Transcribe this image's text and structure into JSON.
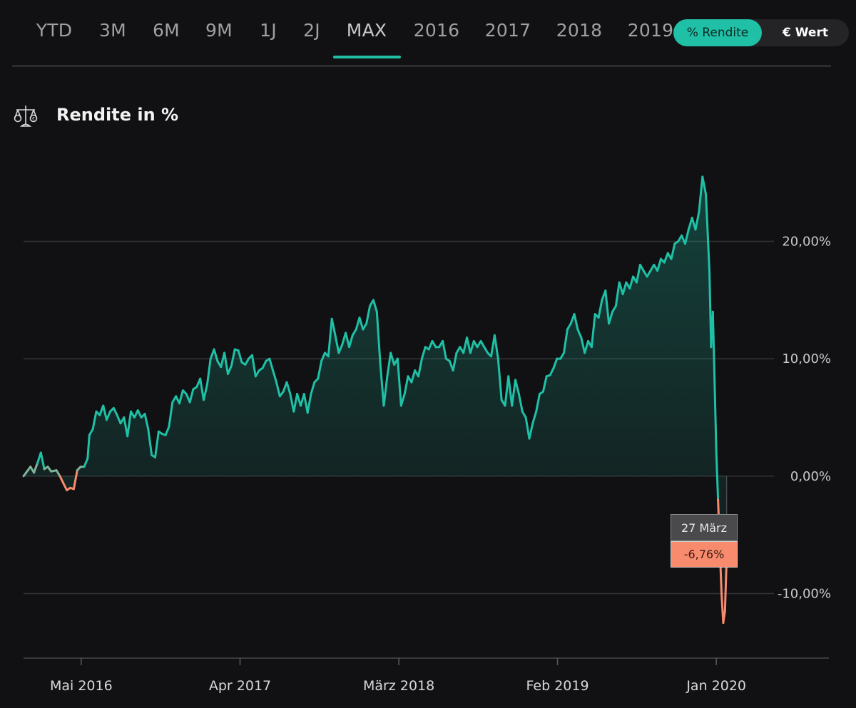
{
  "tabs": [
    {
      "label": "YTD",
      "active": false
    },
    {
      "label": "3M",
      "active": false
    },
    {
      "label": "6M",
      "active": false
    },
    {
      "label": "9M",
      "active": false
    },
    {
      "label": "1J",
      "active": false
    },
    {
      "label": "2J",
      "active": false
    },
    {
      "label": "MAX",
      "active": true
    },
    {
      "label": "2016",
      "active": false
    },
    {
      "label": "2017",
      "active": false
    },
    {
      "label": "2018",
      "active": false
    },
    {
      "label": "2019",
      "active": false
    }
  ],
  "toggle": {
    "percent_label": "% Rendite",
    "value_label": "€ Wert",
    "selected": "percent"
  },
  "section": {
    "title": "Rendite in %",
    "icon": "scale-icon"
  },
  "tooltip": {
    "date": "27 März",
    "value": "-6,76%"
  },
  "colors": {
    "positive": "#1fc0a6",
    "negative": "#f88a6e",
    "background": "#111113"
  },
  "chart_data": {
    "type": "area",
    "y_tick_labels": [
      "20,00%",
      "10,00%",
      "0,00%",
      "-10,00%"
    ],
    "y_ticks": [
      20,
      10,
      0,
      -10
    ],
    "ylim": [
      -15.5,
      27.5
    ],
    "x_tick_labels": [
      "Mai 2016",
      "Apr 2017",
      "März 2018",
      "Feb 2019",
      "Jan 2020"
    ],
    "x_ticks": [
      2016.333,
      2017.25,
      2018.167,
      2019.083,
      2020.0
    ],
    "xlim": [
      2016.0,
      2020.65
    ],
    "grid": true,
    "series": [
      {
        "points": [
          [
            2016.0,
            0.0
          ],
          [
            2016.02,
            0.4
          ],
          [
            2016.04,
            0.8
          ],
          [
            2016.06,
            0.3
          ],
          [
            2016.08,
            1.1
          ],
          [
            2016.1,
            2.0
          ],
          [
            2016.12,
            0.6
          ],
          [
            2016.14,
            0.8
          ],
          [
            2016.16,
            0.4
          ],
          [
            2016.19,
            0.5
          ],
          [
            2016.21,
            0.0
          ],
          [
            2016.23,
            -0.6
          ],
          [
            2016.25,
            -1.2
          ],
          [
            2016.27,
            -1.0
          ],
          [
            2016.29,
            -1.1
          ],
          [
            2016.31,
            0.5
          ],
          [
            2016.33,
            0.8
          ],
          [
            2016.35,
            0.8
          ],
          [
            2016.37,
            1.5
          ],
          [
            2016.38,
            3.5
          ],
          [
            2016.4,
            4.0
          ],
          [
            2016.42,
            5.5
          ],
          [
            2016.44,
            5.2
          ],
          [
            2016.46,
            6.0
          ],
          [
            2016.48,
            4.8
          ],
          [
            2016.5,
            5.5
          ],
          [
            2016.52,
            5.8
          ],
          [
            2016.54,
            5.2
          ],
          [
            2016.56,
            4.5
          ],
          [
            2016.58,
            5.0
          ],
          [
            2016.6,
            3.4
          ],
          [
            2016.62,
            5.5
          ],
          [
            2016.64,
            5.0
          ],
          [
            2016.66,
            5.6
          ],
          [
            2016.68,
            5.0
          ],
          [
            2016.7,
            5.3
          ],
          [
            2016.72,
            4.0
          ],
          [
            2016.74,
            1.8
          ],
          [
            2016.76,
            1.6
          ],
          [
            2016.78,
            3.8
          ],
          [
            2016.8,
            3.6
          ],
          [
            2016.82,
            3.5
          ],
          [
            2016.84,
            4.2
          ],
          [
            2016.86,
            6.3
          ],
          [
            2016.88,
            6.8
          ],
          [
            2016.9,
            6.2
          ],
          [
            2016.92,
            7.3
          ],
          [
            2016.94,
            7.0
          ],
          [
            2016.96,
            6.3
          ],
          [
            2016.98,
            7.4
          ],
          [
            2017.0,
            7.6
          ],
          [
            2017.02,
            8.3
          ],
          [
            2017.04,
            6.5
          ],
          [
            2017.06,
            7.8
          ],
          [
            2017.08,
            10.0
          ],
          [
            2017.1,
            10.8
          ],
          [
            2017.12,
            9.8
          ],
          [
            2017.14,
            9.3
          ],
          [
            2017.16,
            10.5
          ],
          [
            2017.18,
            8.7
          ],
          [
            2017.2,
            9.4
          ],
          [
            2017.22,
            10.8
          ],
          [
            2017.24,
            10.7
          ],
          [
            2017.26,
            9.7
          ],
          [
            2017.28,
            9.5
          ],
          [
            2017.3,
            10.0
          ],
          [
            2017.32,
            10.3
          ],
          [
            2017.34,
            8.5
          ],
          [
            2017.36,
            9.0
          ],
          [
            2017.38,
            9.2
          ],
          [
            2017.4,
            9.8
          ],
          [
            2017.42,
            10.0
          ],
          [
            2017.44,
            9.0
          ],
          [
            2017.46,
            8.0
          ],
          [
            2017.48,
            6.8
          ],
          [
            2017.5,
            7.2
          ],
          [
            2017.52,
            8.0
          ],
          [
            2017.54,
            7.0
          ],
          [
            2017.56,
            5.5
          ],
          [
            2017.58,
            7.0
          ],
          [
            2017.6,
            6.0
          ],
          [
            2017.62,
            7.0
          ],
          [
            2017.64,
            5.4
          ],
          [
            2017.66,
            7.0
          ],
          [
            2017.68,
            8.0
          ],
          [
            2017.7,
            8.3
          ],
          [
            2017.72,
            9.8
          ],
          [
            2017.74,
            10.5
          ],
          [
            2017.76,
            10.2
          ],
          [
            2017.78,
            13.4
          ],
          [
            2017.8,
            12.0
          ],
          [
            2017.82,
            10.5
          ],
          [
            2017.84,
            11.2
          ],
          [
            2017.86,
            12.2
          ],
          [
            2017.88,
            11.0
          ],
          [
            2017.9,
            12.0
          ],
          [
            2017.92,
            12.5
          ],
          [
            2017.94,
            13.5
          ],
          [
            2017.96,
            12.5
          ],
          [
            2017.98,
            13.0
          ],
          [
            2018.0,
            14.5
          ],
          [
            2018.02,
            15.0
          ],
          [
            2018.04,
            14.0
          ],
          [
            2018.06,
            9.5
          ],
          [
            2018.08,
            6.0
          ],
          [
            2018.1,
            8.5
          ],
          [
            2018.12,
            10.5
          ],
          [
            2018.14,
            9.5
          ],
          [
            2018.16,
            10.0
          ],
          [
            2018.18,
            6.0
          ],
          [
            2018.2,
            7.0
          ],
          [
            2018.22,
            8.5
          ],
          [
            2018.24,
            8.0
          ],
          [
            2018.26,
            9.0
          ],
          [
            2018.28,
            8.5
          ],
          [
            2018.3,
            10.0
          ],
          [
            2018.32,
            11.0
          ],
          [
            2018.34,
            10.8
          ],
          [
            2018.36,
            11.5
          ],
          [
            2018.38,
            11.0
          ],
          [
            2018.4,
            11.0
          ],
          [
            2018.42,
            11.5
          ],
          [
            2018.44,
            10.0
          ],
          [
            2018.46,
            9.8
          ],
          [
            2018.48,
            9.0
          ],
          [
            2018.5,
            10.5
          ],
          [
            2018.52,
            11.0
          ],
          [
            2018.54,
            10.5
          ],
          [
            2018.56,
            11.8
          ],
          [
            2018.58,
            10.5
          ],
          [
            2018.6,
            11.5
          ],
          [
            2018.62,
            11.0
          ],
          [
            2018.64,
            11.5
          ],
          [
            2018.66,
            11.0
          ],
          [
            2018.68,
            10.5
          ],
          [
            2018.7,
            10.2
          ],
          [
            2018.72,
            12.0
          ],
          [
            2018.74,
            10.0
          ],
          [
            2018.76,
            6.5
          ],
          [
            2018.78,
            6.0
          ],
          [
            2018.8,
            8.5
          ],
          [
            2018.82,
            6.0
          ],
          [
            2018.84,
            8.2
          ],
          [
            2018.86,
            7.0
          ],
          [
            2018.88,
            5.5
          ],
          [
            2018.9,
            5.0
          ],
          [
            2018.92,
            3.2
          ],
          [
            2018.94,
            4.5
          ],
          [
            2018.96,
            5.5
          ],
          [
            2018.98,
            7.0
          ],
          [
            2019.0,
            7.2
          ],
          [
            2019.02,
            8.5
          ],
          [
            2019.04,
            8.6
          ],
          [
            2019.06,
            9.2
          ],
          [
            2019.08,
            10.0
          ],
          [
            2019.1,
            10.0
          ],
          [
            2019.12,
            10.5
          ],
          [
            2019.14,
            12.5
          ],
          [
            2019.16,
            13.0
          ],
          [
            2019.18,
            13.8
          ],
          [
            2019.2,
            12.5
          ],
          [
            2019.22,
            11.8
          ],
          [
            2019.24,
            10.5
          ],
          [
            2019.26,
            11.5
          ],
          [
            2019.28,
            11.0
          ],
          [
            2019.3,
            13.8
          ],
          [
            2019.32,
            13.5
          ],
          [
            2019.34,
            15.0
          ],
          [
            2019.36,
            15.8
          ],
          [
            2019.38,
            13.0
          ],
          [
            2019.4,
            14.0
          ],
          [
            2019.42,
            14.5
          ],
          [
            2019.44,
            16.5
          ],
          [
            2019.46,
            15.5
          ],
          [
            2019.48,
            16.5
          ],
          [
            2019.5,
            16.0
          ],
          [
            2019.52,
            17.0
          ],
          [
            2019.54,
            16.5
          ],
          [
            2019.56,
            18.0
          ],
          [
            2019.58,
            17.5
          ],
          [
            2019.6,
            17.0
          ],
          [
            2019.62,
            17.5
          ],
          [
            2019.64,
            18.0
          ],
          [
            2019.66,
            17.5
          ],
          [
            2019.68,
            18.5
          ],
          [
            2019.7,
            18.2
          ],
          [
            2019.72,
            19.0
          ],
          [
            2019.74,
            18.5
          ],
          [
            2019.76,
            19.8
          ],
          [
            2019.78,
            20.0
          ],
          [
            2019.8,
            20.5
          ],
          [
            2019.82,
            19.8
          ],
          [
            2019.84,
            21.0
          ],
          [
            2019.86,
            22.0
          ],
          [
            2019.88,
            21.0
          ],
          [
            2019.9,
            22.5
          ],
          [
            2019.92,
            25.5
          ],
          [
            2019.94,
            24.0
          ],
          [
            2019.96,
            17.5
          ],
          [
            2019.97,
            11.0
          ],
          [
            2019.98,
            14.0
          ],
          [
            2019.99,
            8.0
          ],
          [
            2020.0,
            2.0
          ],
          [
            2020.01,
            -2.0
          ],
          [
            2020.02,
            -6.0
          ],
          [
            2020.03,
            -10.0
          ],
          [
            2020.04,
            -12.5
          ],
          [
            2020.05,
            -11.5
          ],
          [
            2020.06,
            -6.76
          ]
        ]
      }
    ]
  }
}
